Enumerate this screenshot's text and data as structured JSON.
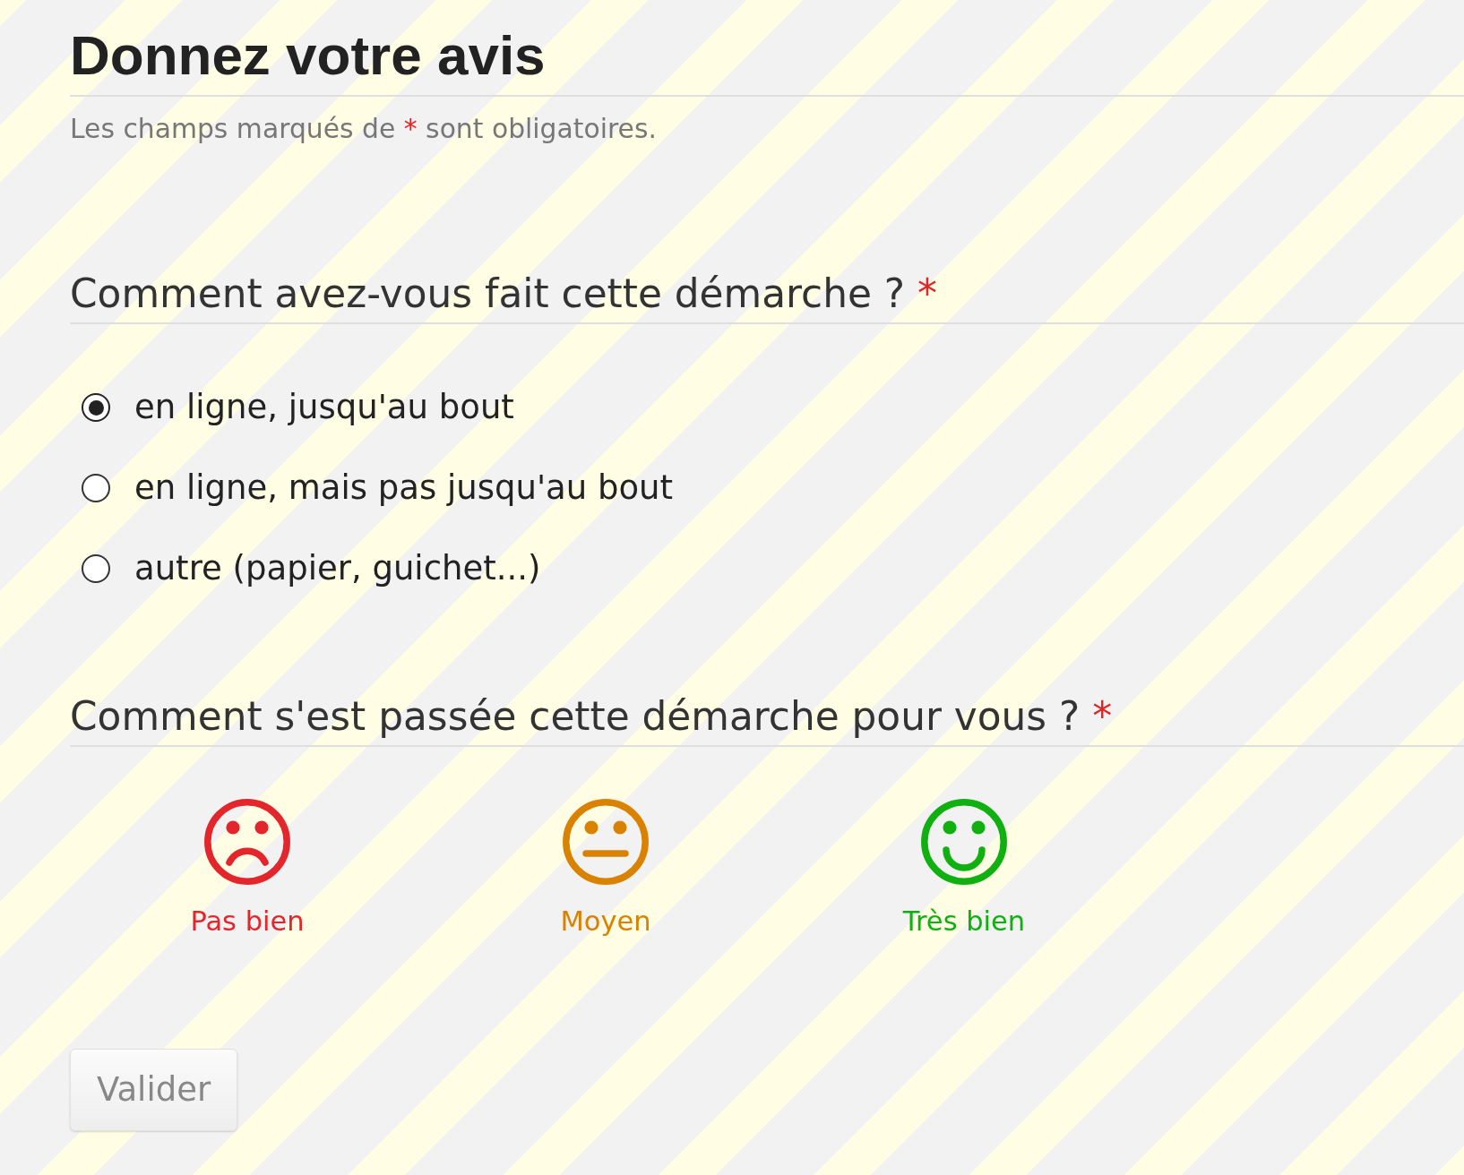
{
  "title": "Donnez votre avis",
  "required_note": {
    "before": "Les champs marqués de",
    "marker": "*",
    "after": "sont obligatoires."
  },
  "questions": [
    {
      "kind": "radio",
      "text": "Comment avez-vous fait cette démarche ?",
      "required_marker": "*",
      "options": [
        {
          "label": "en ligne, jusqu'au bout",
          "selected": true
        },
        {
          "label": "en ligne, mais pas jusqu'au bout",
          "selected": false
        },
        {
          "label": "autre (papier, guichet...)",
          "selected": false
        }
      ]
    },
    {
      "kind": "rating",
      "text": "Comment s'est passée cette démarche pour vous ?",
      "required_marker": "*",
      "options": [
        {
          "kind": "sad",
          "label": "Pas bien",
          "color": "#e3262b",
          "selected": false
        },
        {
          "kind": "neutral",
          "label": "Moyen",
          "color": "#d88200",
          "selected": false
        },
        {
          "kind": "happy",
          "label": "Très bien",
          "color": "#0fb010",
          "selected": false
        }
      ]
    }
  ],
  "submit": {
    "label": "Valider",
    "disabled": true
  }
}
